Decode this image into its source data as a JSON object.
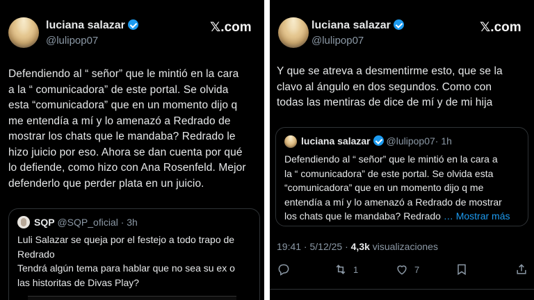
{
  "left": {
    "author_name": "luciana salazar",
    "author_handle": "@lulipop07",
    "brand": "𝕏.com",
    "text": "Defendiendo al “ señor”  que le mintió en la cara\na la “ comunicadora” de este portal. Se olvida\nesta “comunicadora” que en un momento dijo q\nme entendía a mí y lo amenazó a Redrado de\nmostrar los chats que le mandaba? Redrado le\nhizo juicio por eso.  Ahora se dan cuenta por qué\nlo defiende, como hizo con Ana Rosenfeld. Mejor\ndefenderlo que perder plata en un juicio.",
    "quote": {
      "name": "SQP",
      "handle": "@SQP_oficial",
      "time": "· 3h",
      "text": "Luli Salazar se queja por el festejo a todo trapo de\nRedrado\nTendrá algún tema para hablar que no sea su ex o\nlas historitas de Divas Play?"
    }
  },
  "right": {
    "author_name": "luciana salazar",
    "author_handle": "@lulipop07",
    "brand": "𝕏.com",
    "text": "Y que se atreva a desmentirme esto, que se la\nclavo al ángulo en dos segundos. Como con\ntodas las mentiras de dice de mí y de mi hija",
    "quote": {
      "name": "luciana salazar",
      "handle": "@lulipop07",
      "time": "· 1h",
      "text": "Defendiendo al “ señor”  que le mintió en la cara a\nla “ comunicadora” de este portal. Se olvida esta\n“comunicadora” que en un momento dijo q me\nentendía a mí y lo amenazó a Redrado de mostrar\nlos chats que le mandaba? Redrado",
      "more": " … Mostrar más"
    },
    "meta": {
      "time": "19:41 · 5/12/25 · ",
      "views": "4,3k",
      "views_label": " visualizaciones"
    },
    "actions": {
      "reposts": "1",
      "likes": "7"
    }
  },
  "icons": [
    "verified-badge-icon",
    "reply-icon",
    "repost-icon",
    "like-icon",
    "bookmark-icon",
    "share-icon"
  ],
  "colors": {
    "background": "#000000",
    "text": "#e7e9ea",
    "muted": "#8b98a5",
    "accent": "#1d9bf0",
    "border": "#2f3336"
  }
}
